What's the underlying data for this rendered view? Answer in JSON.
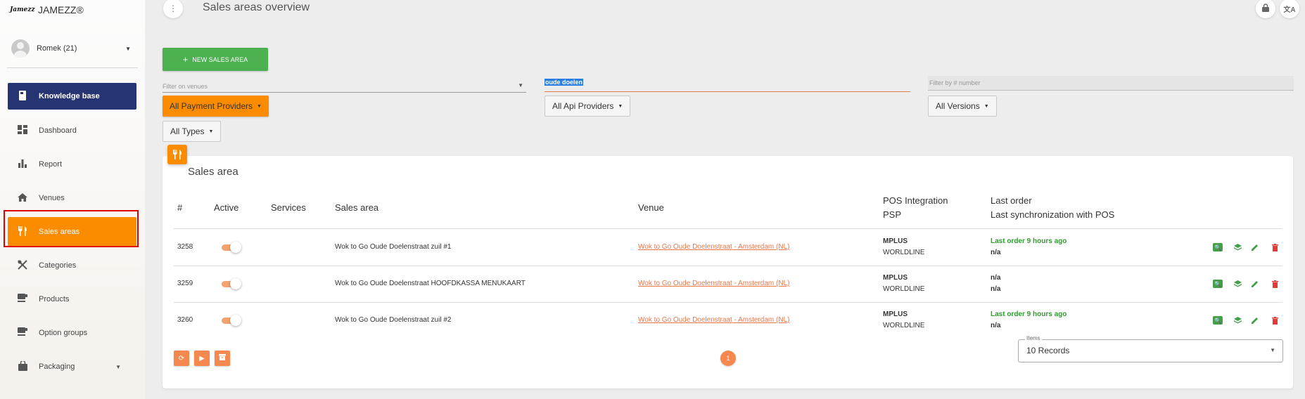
{
  "app": {
    "brand": "JAMEZZ®",
    "logo_text": "Jamezz"
  },
  "user": {
    "name": "Romek (21)"
  },
  "sidebar": {
    "knowledge_base": "Knowledge base",
    "items": [
      {
        "label": "Dashboard",
        "icon": "dashboard-icon"
      },
      {
        "label": "Report",
        "icon": "bar-chart-icon"
      },
      {
        "label": "Venues",
        "icon": "home-icon"
      },
      {
        "label": "Sales areas",
        "icon": "fork-knife-icon"
      },
      {
        "label": "Categories",
        "icon": "utensils-crossed-icon"
      },
      {
        "label": "Products",
        "icon": "coffee-icon"
      },
      {
        "label": "Option groups",
        "icon": "coffee-icon"
      },
      {
        "label": "Packaging",
        "icon": "shopping-bag-icon"
      }
    ]
  },
  "header": {
    "title": "Sales areas overview"
  },
  "toolbar": {
    "new_label": "NEW SALES AREA"
  },
  "filters": {
    "venues_placeholder": "Filter on venues",
    "search_value": "oude doelen",
    "number_placeholder": "Filter by # number",
    "payment": "All Payment Providers",
    "api": "All Api Providers",
    "versions": "All Versions",
    "types": "All Types"
  },
  "table": {
    "title": "Sales area",
    "headers": {
      "num": "#",
      "active": "Active",
      "services": "Services",
      "sales_area": "Sales area",
      "venue": "Venue",
      "pos": "POS Integration",
      "psp": "PSP",
      "last_order": "Last order",
      "last_sync": "Last synchronization with POS"
    },
    "rows": [
      {
        "id": "3258",
        "active": true,
        "name": "Wok to Go Oude Doelenstraat zuil #1",
        "venue": "Wok to Go Oude Doelenstraat - Amsterdam (NL)",
        "pos": "MPLUS",
        "psp": "WORLDLINE",
        "last_order": "Last order 9 hours ago",
        "last_sync": "n/a"
      },
      {
        "id": "3259",
        "active": true,
        "name": "Wok to Go Oude Doelenstraat HOOFDKASSA MENUKAART",
        "venue": "Wok to Go Oude Doelenstraat - Amsterdam (NL)",
        "pos": "MPLUS",
        "psp": "WORLDLINE",
        "last_order": "n/a",
        "last_sync": "n/a"
      },
      {
        "id": "3260",
        "active": true,
        "name": "Wok to Go Oude Doelenstraat zuil #2",
        "venue": "Wok to Go Oude Doelenstraat - Amsterdam (NL)",
        "pos": "MPLUS",
        "psp": "WORLDLINE",
        "last_order": "Last order 9 hours ago",
        "last_sync": "n/a"
      }
    ]
  },
  "pagination": {
    "current_page": "1",
    "items_label": "Items",
    "items_value": "10 Records"
  },
  "colors": {
    "accent": "#fb8c00",
    "primary_dark": "#263474",
    "success": "#4caf50",
    "danger": "#e53935",
    "link": "#e8774a"
  }
}
